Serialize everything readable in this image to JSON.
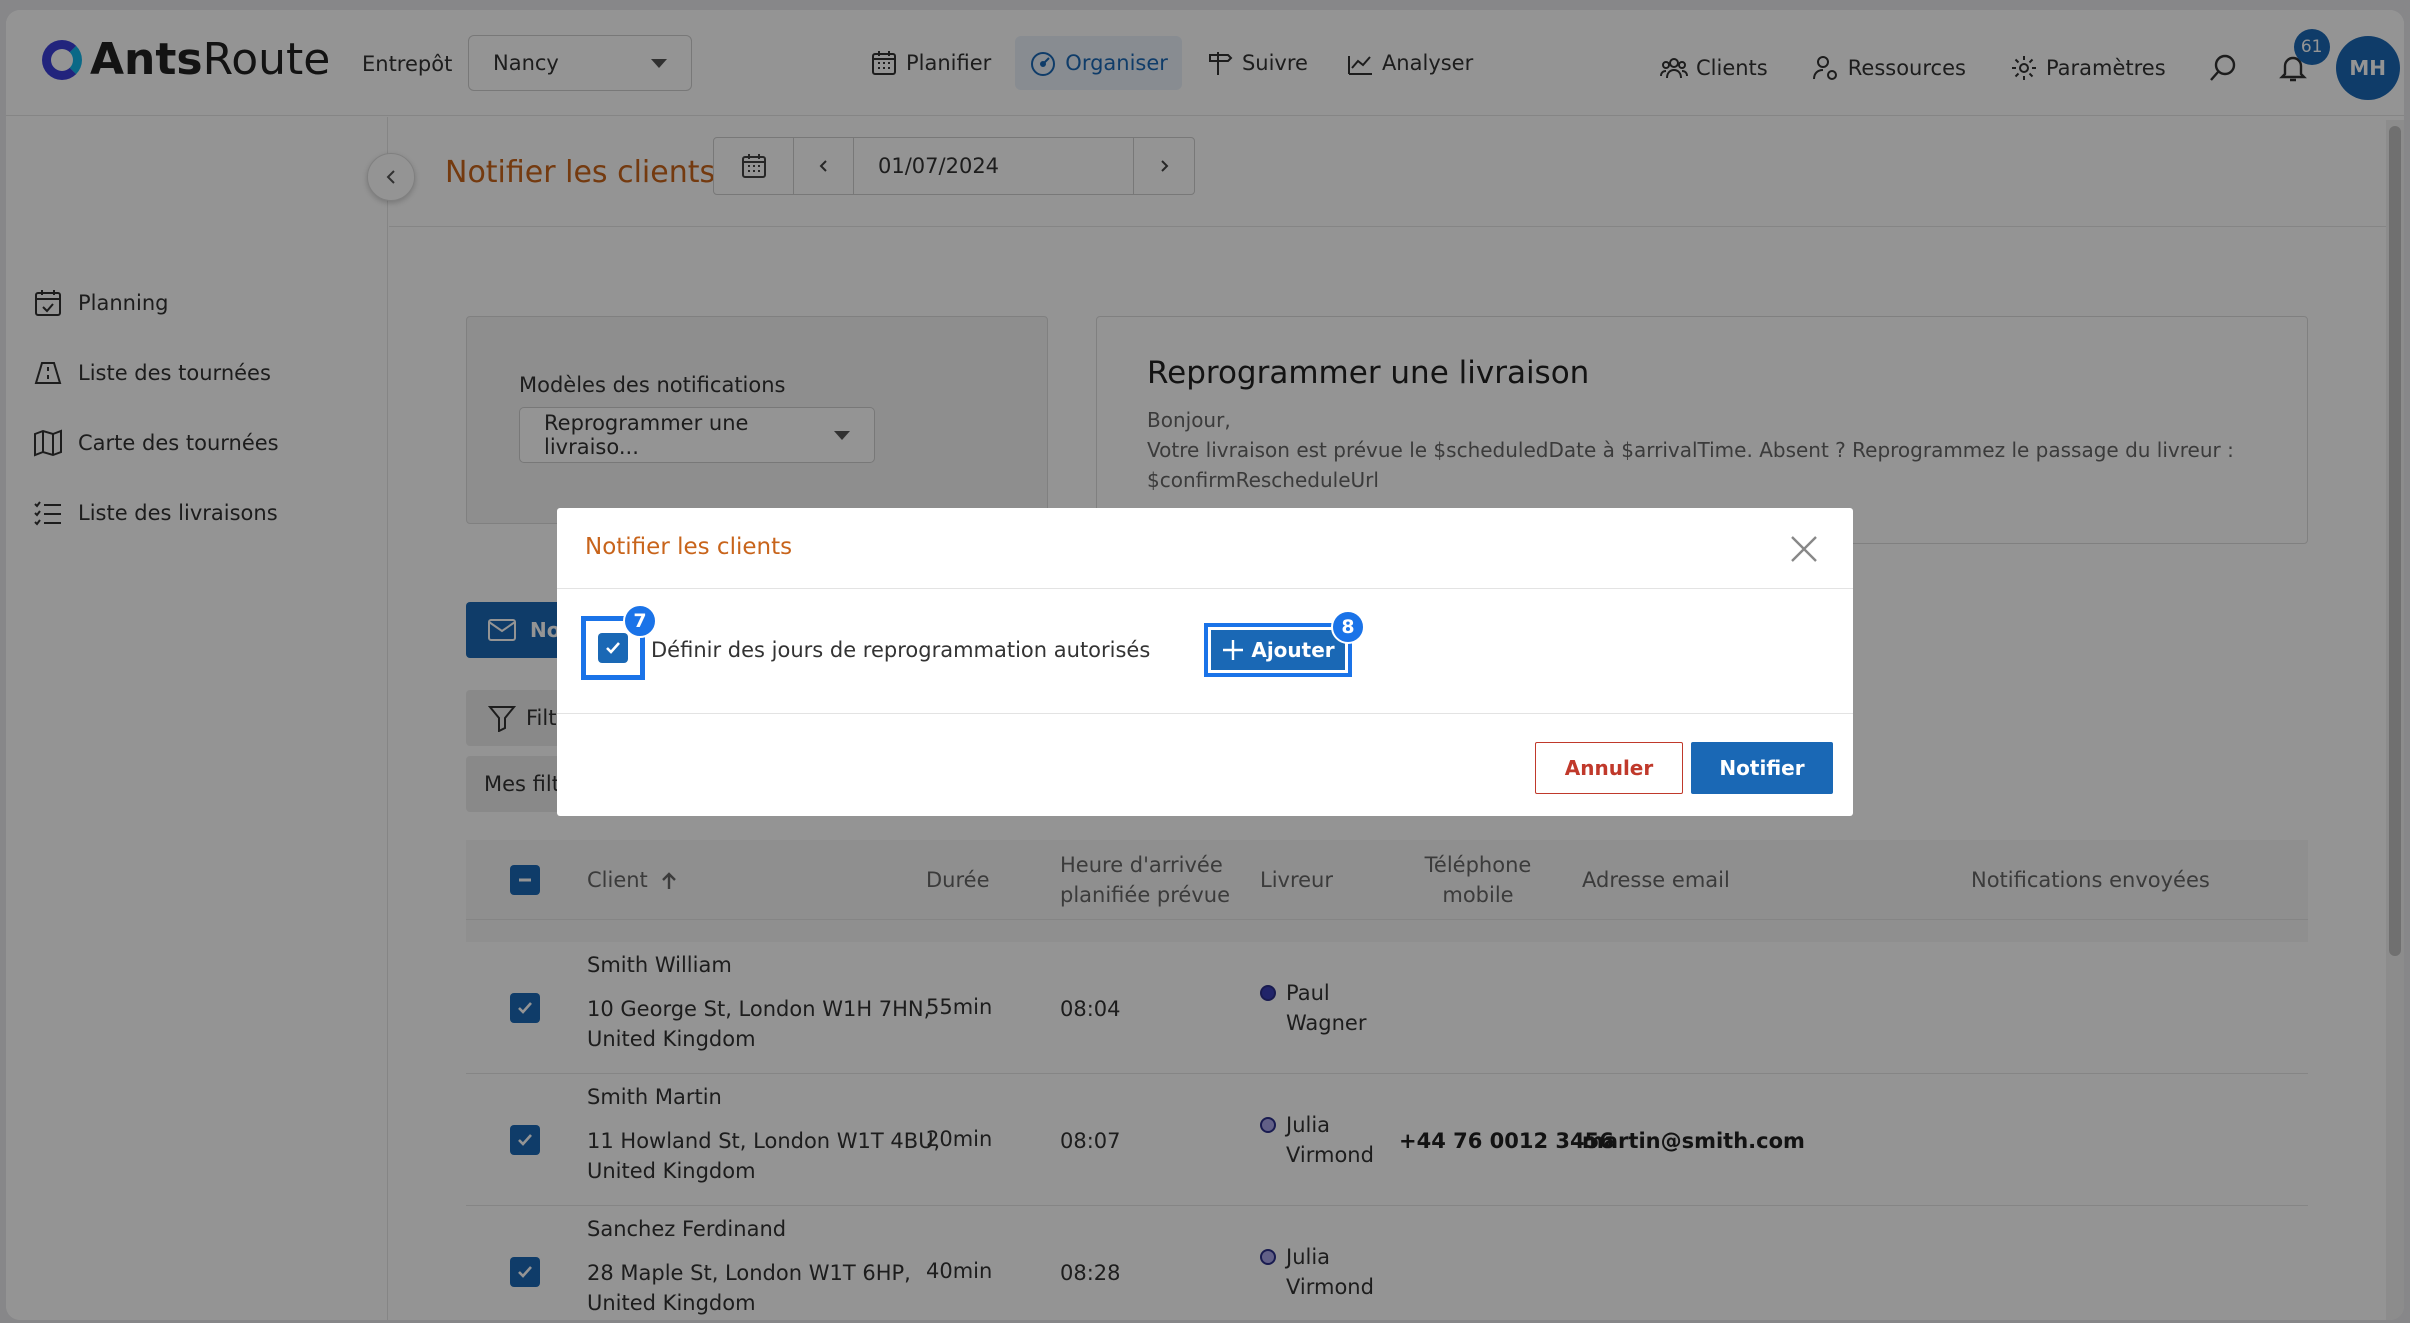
{
  "app": {
    "name_a": "Ants",
    "name_b": "Route"
  },
  "header": {
    "warehouse_label": "Entrepôt",
    "warehouse_value": "Nancy",
    "nav": [
      {
        "label": "Planifier",
        "icon": "calendar-grid-icon"
      },
      {
        "label": "Organiser",
        "icon": "gauge-icon",
        "active": true
      },
      {
        "label": "Suivre",
        "icon": "signpost-icon"
      },
      {
        "label": "Analyser",
        "icon": "chart-icon"
      }
    ],
    "right_nav": [
      {
        "label": "Clients",
        "icon": "users-icon"
      },
      {
        "label": "Ressources",
        "icon": "user-gear-icon"
      },
      {
        "label": "Paramètres",
        "icon": "gear-icon"
      }
    ],
    "notification_count": "61",
    "avatar_initials": "MH"
  },
  "sidebar": {
    "items": [
      {
        "label": "Planning",
        "icon": "calendar-check-icon"
      },
      {
        "label": "Liste des tournées",
        "icon": "route-list-icon"
      },
      {
        "label": "Carte des tournées",
        "icon": "map-icon"
      },
      {
        "label": "Liste des livraisons",
        "icon": "list-icon"
      }
    ]
  },
  "page": {
    "title": "Notifier les clients",
    "date": "01/07/2024",
    "template_label": "Modèles des notifications",
    "template_value": "Reprogrammer une livraiso...",
    "preview_title": "Reprogrammer une livraison",
    "preview_line1": "Bonjour,",
    "preview_line2": "Votre livraison est prévue le $scheduledDate à $arrivalTime. Absent ? Reprogrammez le passage du livreur : $confirmRescheduleUrl",
    "notify_button_partial": "No",
    "filter_button_partial": "Filtr",
    "myfilters_button_partial": "Mes filtr"
  },
  "table": {
    "headers": {
      "client": "Client",
      "duration": "Durée",
      "arrival_1": "Heure d'arrivée",
      "arrival_2": "planifiée prévue",
      "driver": "Livreur",
      "phone_1": "Téléphone",
      "phone_2": "mobile",
      "email": "Adresse email",
      "notifications": "Notifications envoyées"
    },
    "rows": [
      {
        "name": "Smith William",
        "addr1": "10 George St, London W1H 7HN,",
        "addr2": "United Kingdom",
        "duration": "55min",
        "arrival": "08:04",
        "driver1": "Paul",
        "driver2": "Wagner",
        "driver_color": "#3a3fb5",
        "phone": "",
        "email": ""
      },
      {
        "name": "Smith Martin",
        "addr1": "11 Howland St, London W1T 4BU,",
        "addr2": "United Kingdom",
        "duration": "20min",
        "arrival": "08:07",
        "driver1": "Julia",
        "driver2": "Virmond",
        "driver_color": "#a9a6e8",
        "phone": "+44 76 0012 3456",
        "email": "martin@smith.com"
      },
      {
        "name": "Sanchez Ferdinand",
        "addr1": "28 Maple St, London W1T 6HP,",
        "addr2": "United Kingdom",
        "duration": "40min",
        "arrival": "08:28",
        "driver1": "Julia",
        "driver2": "Virmond",
        "driver_color": "#a9a6e8",
        "phone": "",
        "email": ""
      }
    ]
  },
  "modal": {
    "title": "Notifier les clients",
    "checkbox_label": "Définir des jours de reprogrammation autorisés",
    "step_checkbox": "7",
    "step_add": "8",
    "add_label": "Ajouter",
    "cancel_label": "Annuler",
    "notify_label": "Notifier"
  },
  "colors": {
    "primary": "#1a68b5",
    "accent_title": "#c8641b",
    "cancel": "#c0392b",
    "highlight": "#1a73e8"
  }
}
